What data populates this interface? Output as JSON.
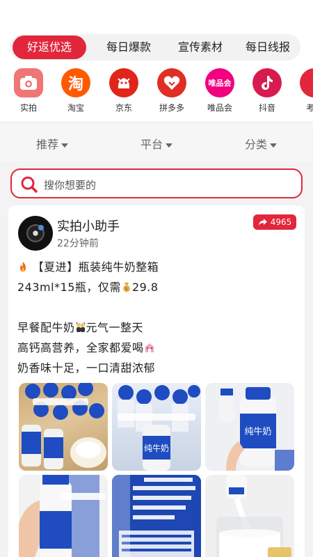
{
  "tabs": [
    {
      "label": "好返优选",
      "active": true
    },
    {
      "label": "每日爆款",
      "active": false
    },
    {
      "label": "宣传素材",
      "active": false
    },
    {
      "label": "每日线报",
      "active": false
    }
  ],
  "platforms": [
    {
      "label": "实拍",
      "icon": "camera-icon",
      "color": "#f26b6b"
    },
    {
      "label": "淘宝",
      "icon": "taobao-icon",
      "color": "#ff5a00",
      "glyph": "淘"
    },
    {
      "label": "京东",
      "icon": "jd-icon",
      "color": "#e1251b"
    },
    {
      "label": "拼多多",
      "icon": "pinduoduo-icon",
      "color": "#e02e24"
    },
    {
      "label": "唯品会",
      "icon": "vipshop-icon",
      "color": "#f10180",
      "glyph": "唯品会"
    },
    {
      "label": "抖音",
      "icon": "douyin-icon",
      "color": "#e0205a"
    },
    {
      "label": "考",
      "icon": "kaola-icon",
      "color": "#e2263b"
    }
  ],
  "filters": [
    {
      "label": "推荐"
    },
    {
      "label": "平台"
    },
    {
      "label": "分类"
    }
  ],
  "search": {
    "placeholder": "搜你想要的"
  },
  "post": {
    "author": "实拍小助手",
    "time": "22分钟前",
    "share_count": "4965",
    "lines": [
      "【夏进】瓶装纯牛奶整箱",
      "243ml*15瓶，仅需",
      "29.8",
      "早餐配牛奶",
      "元气一整天",
      "高钙高营养，全家都爱喝",
      "奶香味十足，一口清甜浓郁"
    ],
    "images": [
      {
        "alt": "milk-box-photo"
      },
      {
        "alt": "milk-bottles-photo"
      },
      {
        "alt": "milk-hand-photo"
      },
      {
        "alt": "milk-bottle-hand-photo"
      },
      {
        "alt": "milk-label-photo"
      },
      {
        "alt": "milk-pouring-photo"
      }
    ]
  },
  "colors": {
    "accent": "#e2263b"
  }
}
